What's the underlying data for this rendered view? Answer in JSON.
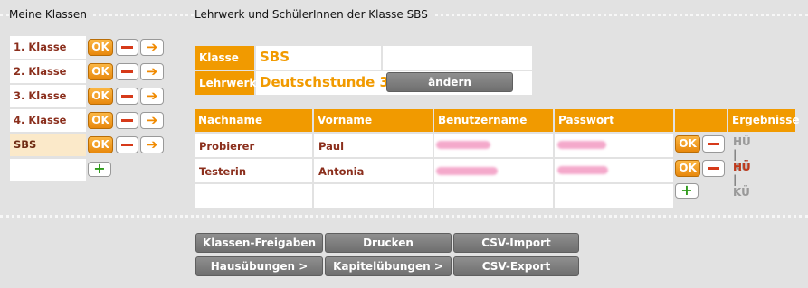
{
  "left_title": "Meine Klassen",
  "right_title": "Lehrwerk und SchülerInnen der Klasse SBS",
  "classes": [
    {
      "name": "1. Klasse"
    },
    {
      "name": "2. Klasse"
    },
    {
      "name": "3. Klasse"
    },
    {
      "name": "4. Klasse"
    },
    {
      "name": "SBS"
    }
  ],
  "buttons": {
    "ok": "OK",
    "arrow": "➔",
    "plus": "+"
  },
  "info": {
    "klasse_label": "Klasse",
    "klasse_value": "SBS",
    "lehrwerk_label": "Lehrwerk",
    "lehrwerk_value": "Deutschstunde 3",
    "change_button": "ändern"
  },
  "students_table": {
    "headers": [
      "Nachname",
      "Vorname",
      "Benutzername",
      "Passwort",
      "",
      "Ergebnisse"
    ],
    "rows": [
      {
        "nachname": "Probierer",
        "vorname": "Paul",
        "results": {
          "hu": "HÜ",
          "sep": "|",
          "ku": "KÜ"
        }
      },
      {
        "nachname": "Testerin",
        "vorname": "Antonia",
        "results": {
          "hu": "HÜ",
          "sep": "|",
          "ku": "KÜ"
        }
      }
    ]
  },
  "bottom_buttons": {
    "row1": [
      "Klassen-Freigaben",
      "Drucken",
      "CSV-Import"
    ],
    "row2": [
      "Hausübungen >",
      "Kapitelübungen >",
      "CSV-Export"
    ]
  },
  "colors": {
    "accent": "#f19a00",
    "name_text": "#8b2f1d",
    "background": "#e2e2e2",
    "plus": "#2e9a1a",
    "minus": "#d63a1a"
  }
}
